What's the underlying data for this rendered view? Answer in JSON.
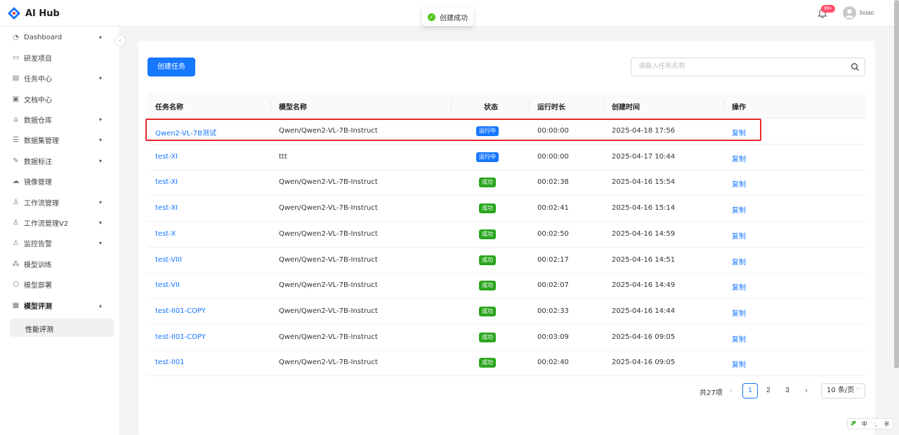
{
  "app": {
    "title": "AI Hub"
  },
  "toast": {
    "message": "创建成功"
  },
  "header": {
    "notification_badge": "99+",
    "username": "lixiao"
  },
  "sidebar": {
    "items": [
      {
        "label": "Dashboard",
        "icon": "dashboard-icon",
        "caret": "down"
      },
      {
        "label": "研发项目",
        "icon": "folder-icon"
      },
      {
        "label": "任务中心",
        "icon": "clipboard-icon",
        "caret": "down"
      },
      {
        "label": "文档中心",
        "icon": "document-icon"
      },
      {
        "label": "数据仓库",
        "icon": "home-icon",
        "caret": "down"
      },
      {
        "label": "数据集管理",
        "icon": "database-icon",
        "caret": "down"
      },
      {
        "label": "数据标注",
        "icon": "pen-icon",
        "caret": "down"
      },
      {
        "label": "镜像管理",
        "icon": "cloud-icon"
      },
      {
        "label": "工作流管理",
        "icon": "workflow-icon",
        "caret": "down"
      },
      {
        "label": "工作流管理V2",
        "icon": "workflow-icon",
        "caret": "down"
      },
      {
        "label": "监控告警",
        "icon": "warning-icon",
        "caret": "down"
      },
      {
        "label": "模型训练",
        "icon": "network-icon"
      },
      {
        "label": "模型部署",
        "icon": "cube-icon"
      },
      {
        "label": "模型评测",
        "icon": "chart-icon",
        "caret": "up"
      }
    ],
    "subitem": "性能评测"
  },
  "toolbar": {
    "create_label": "创建任务",
    "search_placeholder": "请输入任务名称"
  },
  "table": {
    "columns": [
      "任务名称",
      "模型名称",
      "状态",
      "运行时长",
      "创建时间",
      "操作"
    ],
    "rows": [
      {
        "name": "Qwen2-VL-7B测试",
        "model": "Qwen/Qwen2-VL-7B-Instruct",
        "status": "运行中",
        "status_color": "#1677ff",
        "duration": "00:00:00",
        "created": "2025-04-18 17:56",
        "action": "复制"
      },
      {
        "name": "test-XI",
        "model": "ttt",
        "status": "运行中",
        "status_color": "#1677ff",
        "duration": "00:00:00",
        "created": "2025-04-17 10:44",
        "action": "复制"
      },
      {
        "name": "test-XI",
        "model": "Qwen/Qwen2-VL-7B-Instruct",
        "status": "成功",
        "status_color": "#2aa61e",
        "duration": "00:02:38",
        "created": "2025-04-16 15:54",
        "action": "复制"
      },
      {
        "name": "test-XI",
        "model": "Qwen/Qwen2-VL-7B-Instruct",
        "status": "成功",
        "status_color": "#2aa61e",
        "duration": "00:02:41",
        "created": "2025-04-16 15:14",
        "action": "复制"
      },
      {
        "name": "test-X",
        "model": "Qwen/Qwen2-VL-7B-Instruct",
        "status": "成功",
        "status_color": "#2aa61e",
        "duration": "00:02:50",
        "created": "2025-04-16 14:59",
        "action": "复制"
      },
      {
        "name": "test-VIII",
        "model": "Qwen/Qwen2-VL-7B-Instruct",
        "status": "成功",
        "status_color": "#2aa61e",
        "duration": "00:02:17",
        "created": "2025-04-16 14:51",
        "action": "复制"
      },
      {
        "name": "test-VII",
        "model": "Qwen/Qwen2-VL-7B-Instruct",
        "status": "成功",
        "status_color": "#2aa61e",
        "duration": "00:02:07",
        "created": "2025-04-16 14:49",
        "action": "复制"
      },
      {
        "name": "test-II01-COPY",
        "model": "Qwen/Qwen2-VL-7B-Instruct",
        "status": "成功",
        "status_color": "#2aa61e",
        "duration": "00:02:33",
        "created": "2025-04-16 14:44",
        "action": "复制"
      },
      {
        "name": "test-II01-COPY",
        "model": "Qwen/Qwen2-VL-7B-Instruct",
        "status": "成功",
        "status_color": "#2aa61e",
        "duration": "00:03:09",
        "created": "2025-04-16 09:05",
        "action": "复制"
      },
      {
        "name": "test-II01",
        "model": "Qwen/Qwen2-VL-7B-Instruct",
        "status": "成功",
        "status_color": "#2aa61e",
        "duration": "00:02:40",
        "created": "2025-04-16 09:05",
        "action": "复制"
      }
    ]
  },
  "pagination": {
    "total": "共27项",
    "pages": [
      "1",
      "2",
      "3"
    ],
    "current": "1",
    "page_size": "10 条/页"
  },
  "ime": {
    "labels": [
      "中",
      "·,",
      "半"
    ]
  }
}
